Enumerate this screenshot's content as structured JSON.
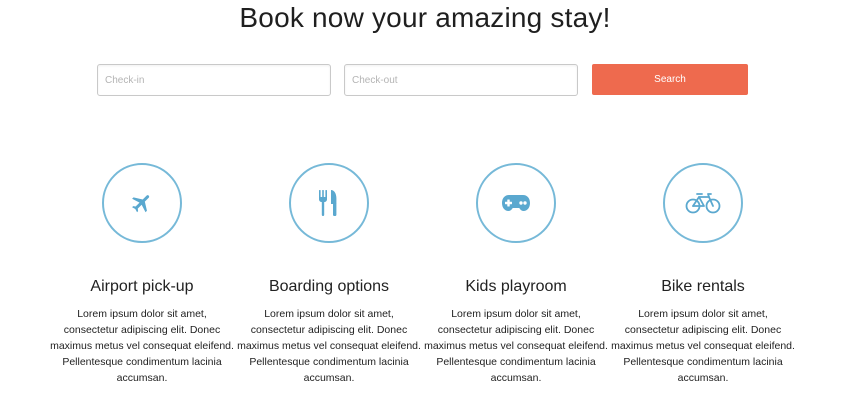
{
  "header": {
    "title": "Book now your amazing stay!"
  },
  "booking": {
    "checkin_placeholder": "Check-in",
    "checkout_placeholder": "Check-out",
    "search_label": "Search"
  },
  "features": [
    {
      "icon": "airplane-icon",
      "title": "Airport pick-up",
      "desc": "Lorem ipsum dolor sit amet, consectetur adipiscing elit. Donec maximus metus vel consequat eleifend. Pellentesque condimentum lacinia accumsan."
    },
    {
      "icon": "fork-knife-icon",
      "title": "Boarding options",
      "desc": "Lorem ipsum dolor sit amet, consectetur adipiscing elit. Donec maximus metus vel consequat eleifend. Pellentesque condimentum lacinia accumsan."
    },
    {
      "icon": "gamepad-icon",
      "title": "Kids playroom",
      "desc": "Lorem ipsum dolor sit amet, consectetur adipiscing elit. Donec maximus metus vel consequat eleifend. Pellentesque condimentum lacinia accumsan."
    },
    {
      "icon": "bicycle-icon",
      "title": "Bike rentals",
      "desc": "Lorem ipsum dolor sit amet, consectetur adipiscing elit. Donec maximus metus vel consequat eleifend. Pellentesque condimentum lacinia accumsan."
    }
  ],
  "colors": {
    "accent": "#ee6a4e",
    "icon": "#5aa8cf",
    "circle_border": "#76b9d8"
  }
}
